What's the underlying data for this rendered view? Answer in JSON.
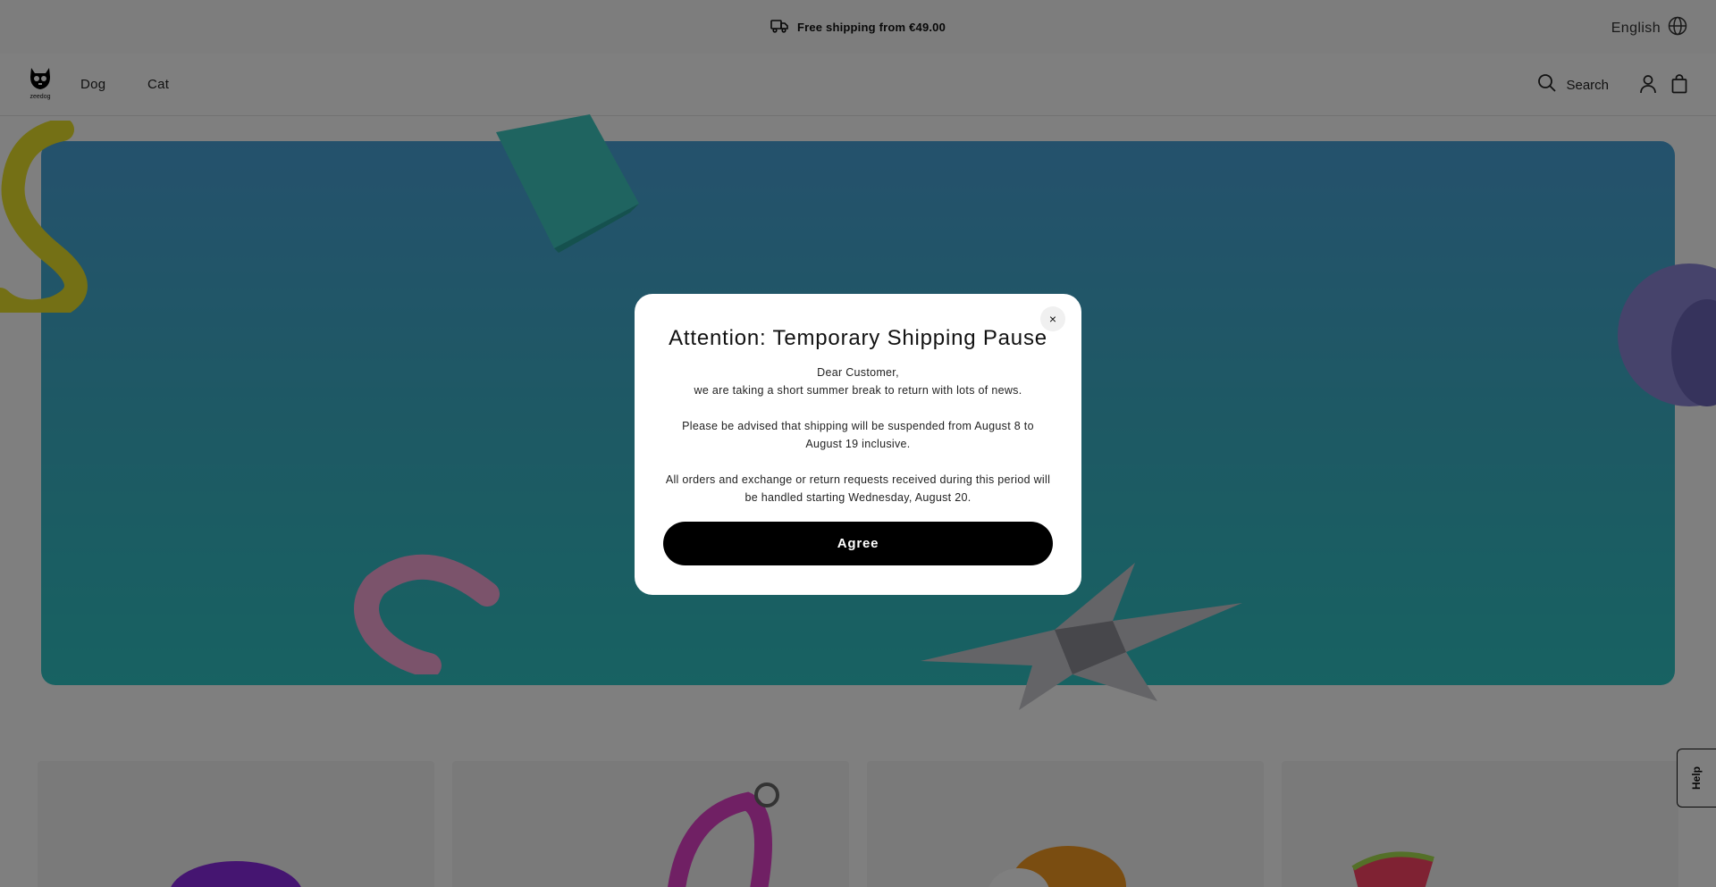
{
  "announcement": {
    "text": "Free shipping from €49.00",
    "icon": "truck-icon"
  },
  "language": {
    "label": "English",
    "icon": "globe-icon"
  },
  "header": {
    "logo_text": "zeedog",
    "nav": [
      {
        "label": "Dog"
      },
      {
        "label": "Cat"
      }
    ],
    "search_label": "Search"
  },
  "help_label": "Help",
  "modal": {
    "title": "Attention: Temporary Shipping Pause",
    "close_label": "×",
    "greeting": "Dear Customer,",
    "line1": "we are taking a short summer break to return with lots of news.",
    "para2": "Please be advised that shipping will be suspended from August 8 to August 19 inclusive.",
    "para3": "All orders and exchange or return requests received during this period will be handled starting Wednesday, August 20.",
    "agree_label": "Agree"
  },
  "colors": {
    "overlay": "rgba(0,0,0,0.5)",
    "button": "#000000",
    "hero_top": "#4aa3d9",
    "hero_bottom": "#2fc4c4"
  }
}
